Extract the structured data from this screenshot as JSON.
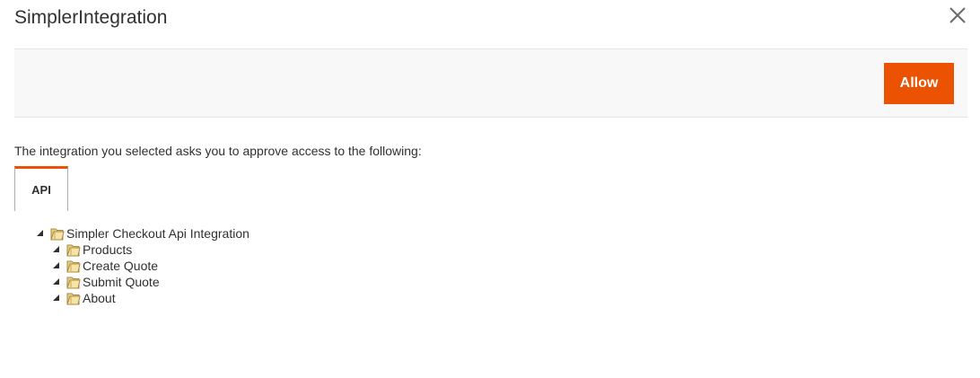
{
  "modal": {
    "title": "SimplerIntegration",
    "close_icon": "close-icon"
  },
  "actions": {
    "allow_label": "Allow",
    "accent_color": "#eb5202"
  },
  "intro_text": "The integration you selected asks you to approve access to the following:",
  "tabs": [
    {
      "label": "API",
      "active": true
    }
  ],
  "tree": {
    "root": {
      "label": "Simpler Checkout Api Integration",
      "expanded": true,
      "icon": "folder-icon"
    },
    "children": [
      {
        "label": "Products",
        "expanded": true,
        "icon": "folder-icon"
      },
      {
        "label": "Create Quote",
        "expanded": true,
        "icon": "folder-icon"
      },
      {
        "label": "Submit Quote",
        "expanded": true,
        "icon": "folder-icon"
      },
      {
        "label": "About",
        "expanded": true,
        "icon": "folder-icon"
      }
    ]
  }
}
